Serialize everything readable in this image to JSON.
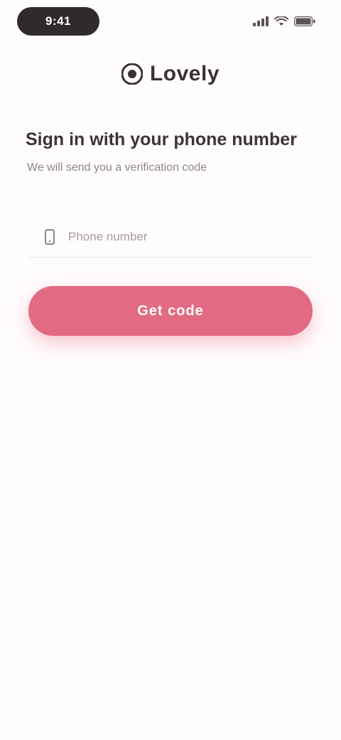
{
  "status_bar": {
    "time": "9:41",
    "signal_icon": "signal-icon",
    "wifi_icon": "wifi-icon",
    "battery_icon": "battery-icon"
  },
  "header": {
    "logo_icon": "app-logo-icon",
    "brand_name": "Lovely"
  },
  "login": {
    "title": "Sign in with your phone number",
    "subtitle": "We will send you a verification code",
    "phone_placeholder": "Phone number",
    "phone_value": "",
    "phone_icon": "phone-icon",
    "submit_label": "Get code"
  },
  "colors": {
    "accent": "#e26a82",
    "background": "#fffcfd",
    "text_primary": "#3d3438",
    "text_secondary": "#8e8589"
  }
}
